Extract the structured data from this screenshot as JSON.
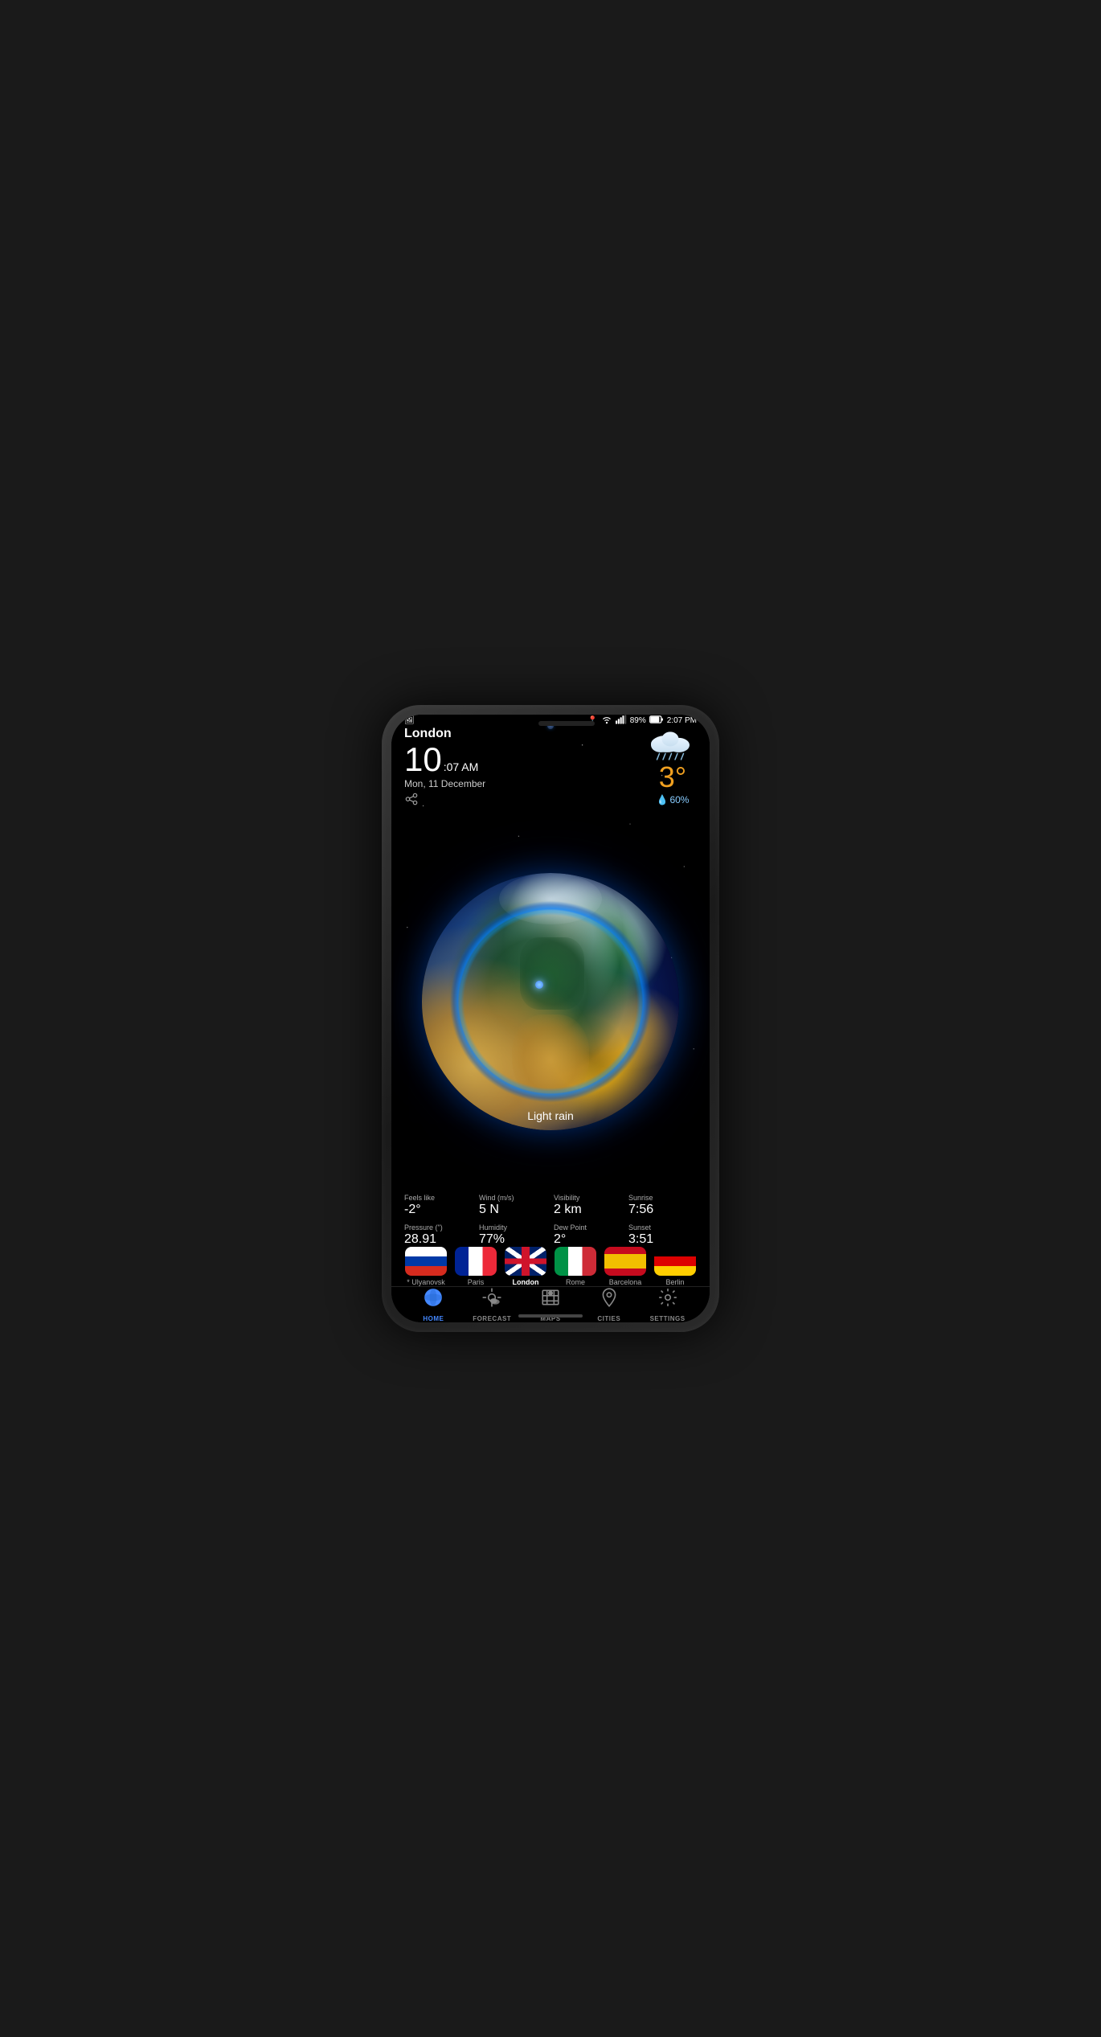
{
  "phone": {
    "statusBar": {
      "locationIcon": "📍",
      "wifiIcon": "wifi",
      "signalIcon": "signal",
      "battery": "89%",
      "time": "2:07 PM"
    },
    "header": {
      "city": "London",
      "timeHour": "10",
      "timeMinSec": ":07 AM",
      "date": "Mon, 11 December",
      "shareLabel": "share"
    },
    "weatherTop": {
      "temp": "3°",
      "precipitation": "60%"
    },
    "globe": {
      "weatherLabel": "Light rain"
    },
    "weatherDetails": [
      {
        "label": "Feels like",
        "value": "-2°"
      },
      {
        "label": "Wind (m/s)",
        "value": "5 N"
      },
      {
        "label": "Visibility",
        "value": "2 km"
      },
      {
        "label": "Sunrise",
        "value": "7:56"
      },
      {
        "label": "Pressure (\")",
        "value": "28.91"
      },
      {
        "label": "Humidity",
        "value": "77%"
      },
      {
        "label": "Dew Point",
        "value": "2°"
      },
      {
        "label": "Sunset",
        "value": "3:51"
      }
    ],
    "cities": [
      {
        "name": "Ulyanovsk",
        "flag": "russia",
        "active": false,
        "prefix": "* "
      },
      {
        "name": "Paris",
        "flag": "france",
        "active": false,
        "prefix": ""
      },
      {
        "name": "London",
        "flag": "uk",
        "active": true,
        "prefix": ""
      },
      {
        "name": "Rome",
        "flag": "italy",
        "active": false,
        "prefix": ""
      },
      {
        "name": "Barcelona",
        "flag": "spain",
        "active": false,
        "prefix": ""
      },
      {
        "name": "Berlin",
        "flag": "germany",
        "active": false,
        "prefix": ""
      }
    ],
    "bottomNav": [
      {
        "id": "home",
        "label": "HOME",
        "icon": "🌐",
        "active": true
      },
      {
        "id": "forecast",
        "label": "FORECAST",
        "icon": "⛅",
        "active": false
      },
      {
        "id": "maps",
        "label": "MAPS",
        "icon": "🗺",
        "active": false
      },
      {
        "id": "cities",
        "label": "CITIES",
        "icon": "📍",
        "active": false
      },
      {
        "id": "settings",
        "label": "SETTINGS",
        "icon": "⚙",
        "active": false
      }
    ]
  }
}
